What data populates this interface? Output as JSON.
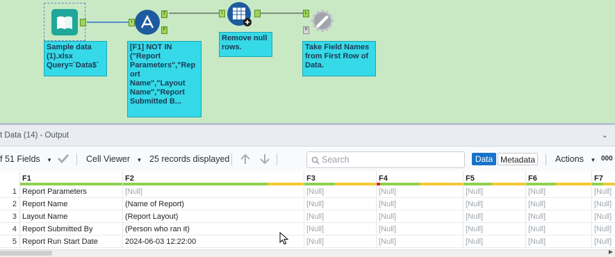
{
  "workflow": {
    "tools": [
      {
        "name": "input-tool",
        "icon": "book-icon",
        "annotation": "Sample data\n(1).xlsx\nQuery=`Data$`"
      },
      {
        "name": "filter-tool",
        "icon": "filter-icon",
        "annotation": "[F1] NOT IN\n(\"Report\nParameters\",\"Rep\nort\nName\",\"Layout\nName\",\"Report\nSubmitted B..."
      },
      {
        "name": "data-cleansing-tool",
        "icon": "cleanse-icon",
        "annotation": "Remove null\nrows."
      },
      {
        "name": "dynamic-rename-tool",
        "icon": "rename-icon",
        "annotation": "Take Field Names\nfrom First Row of\nData."
      }
    ],
    "anchors": {
      "true": "T",
      "false": "F",
      "input": "I",
      "left": "L",
      "right": "R"
    },
    "colors": {
      "canvas": "#c9e9c5",
      "annotation": "#36d9e8",
      "connection": "#2a6fc9"
    }
  },
  "results": {
    "title": "t Data (14) - Output",
    "toolbar": {
      "fields": "f 51 Fields",
      "viewer": "Cell Viewer",
      "records": "25 records displayed",
      "search_placeholder": "Search",
      "data_label": "Data",
      "metadata_label": "Metadata",
      "actions": "Actions",
      "more": "000"
    },
    "columns": [
      "F1",
      "F2",
      "F3",
      "F4",
      "F5",
      "F6",
      "F7"
    ],
    "rows": [
      {
        "n": "1",
        "cells": [
          "Report Parameters",
          "[Null]",
          "[Null]",
          "[Null]",
          "[Null]",
          "[Null]",
          "[Null]"
        ]
      },
      {
        "n": "2",
        "cells": [
          "Report Name",
          "(Name of Report)",
          "[Null]",
          "[Null]",
          "[Null]",
          "[Null]",
          "[Null]"
        ]
      },
      {
        "n": "3",
        "cells": [
          "Layout Name",
          "(Report Layout)",
          "[Null]",
          "[Null]",
          "[Null]",
          "[Null]",
          "[Null]"
        ]
      },
      {
        "n": "4",
        "cells": [
          "Report Submitted By",
          "(Person who ran it)",
          "[Null]",
          "[Null]",
          "[Null]",
          "[Null]",
          "[Null]"
        ]
      },
      {
        "n": "5",
        "cells": [
          "Report Run Start Date",
          "2024-06-03 12:22:00",
          "[Null]",
          "[Null]",
          "[Null]",
          "[Null]",
          "[Null]"
        ]
      }
    ],
    "colors": {
      "accent": "#1673c9",
      "quality_good": "#8fd14f",
      "quality_warn": "#f5c933",
      "quality_bad": "#d9262c"
    }
  }
}
